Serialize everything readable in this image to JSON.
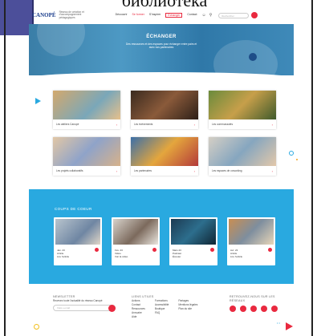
{
  "caption": "библиотека",
  "header": {
    "logo": "CANOPÉ",
    "logo_sub": "Réseau de création et d'accompagnement pédagogiques",
    "nav": [
      "Découvrir",
      "Se former",
      "S'inspirer",
      "Échanger",
      "Contact"
    ],
    "active_index": 3,
    "search_placeholder": "Rechercher"
  },
  "hero": {
    "title": "ÉCHANGER",
    "subtitle": "Des ressources et des espaces pour échanger entre pairs et avec nos partenaires"
  },
  "cards": [
    {
      "label": "Les ateliers Canopé"
    },
    {
      "label": "Les événements"
    },
    {
      "label": "Les communautés"
    },
    {
      "label": "Les projets collaboratifs"
    },
    {
      "label": "Les partenaires"
    },
    {
      "label": "Les espaces de coworking"
    }
  ],
  "coeur": {
    "title": "COUPS DE COEUR",
    "cards": [
      {
        "date": "Jan. 23",
        "type": "Article",
        "tag": "Lire l'article"
      },
      {
        "date": "Fév. 23",
        "type": "Vidéo",
        "tag": "Voir la vidéo"
      },
      {
        "date": "Mars 23",
        "type": "Podcast",
        "tag": "Écouter"
      },
      {
        "date": "Avr. 23",
        "type": "Article",
        "tag": "Lire l'article"
      }
    ]
  },
  "footer": {
    "newsletter_title": "NEWSLETTER",
    "newsletter_text": "Recevez toute l'actualité du réseau Canopé",
    "newsletter_placeholder": "Votre e-mail",
    "links_title": "LIENS UTILES",
    "links_col1": [
      "Actions",
      "Contact",
      "Ressources",
      "Annuaire",
      "Aide"
    ],
    "links_col2": [
      "Formations",
      "Accessibilité",
      "Boutique",
      "FAQ"
    ],
    "links_col3": [
      "Partages",
      "",
      "Mentions légales",
      "Plan du site"
    ],
    "social_title": "RETROUVEZ-NOUS SUR LES RÉSEAUX"
  },
  "colors": {
    "accent": "#e9293f",
    "blue": "#29a9e0",
    "hero": "#3a7ea7"
  }
}
